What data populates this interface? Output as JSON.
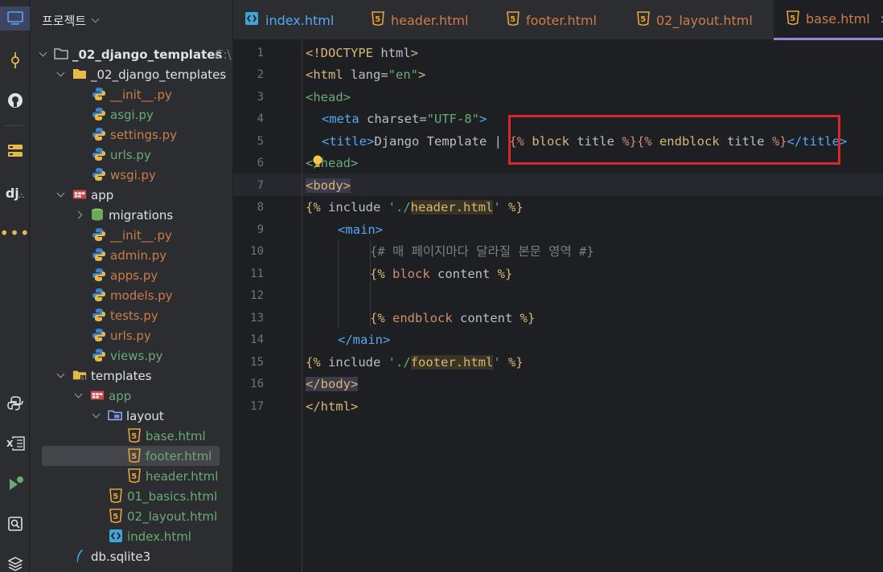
{
  "project_panel": {
    "title": "프로젝트",
    "tree": [
      {
        "label": "_02_django_templates",
        "suffix": "C:\\",
        "type": "root"
      },
      {
        "label": "_02_django_templates",
        "type": "folder"
      },
      {
        "label": "__init__.py",
        "type": "py"
      },
      {
        "label": "asgi.py",
        "type": "py"
      },
      {
        "label": "settings.py",
        "type": "py"
      },
      {
        "label": "urls.py",
        "type": "py"
      },
      {
        "label": "wsgi.py",
        "type": "py"
      },
      {
        "label": "app",
        "type": "app-folder"
      },
      {
        "label": "migrations",
        "type": "db-folder"
      },
      {
        "label": "__init__.py",
        "type": "py"
      },
      {
        "label": "admin.py",
        "type": "py"
      },
      {
        "label": "apps.py",
        "type": "py"
      },
      {
        "label": "models.py",
        "type": "py"
      },
      {
        "label": "tests.py",
        "type": "py"
      },
      {
        "label": "urls.py",
        "type": "py"
      },
      {
        "label": "views.py",
        "type": "py"
      },
      {
        "label": "templates",
        "type": "templates-folder"
      },
      {
        "label": "app",
        "type": "app-folder"
      },
      {
        "label": "layout",
        "type": "layout-folder"
      },
      {
        "label": "base.html",
        "type": "html"
      },
      {
        "label": "footer.html",
        "type": "html"
      },
      {
        "label": "header.html",
        "type": "html"
      },
      {
        "label": "01_basics.html",
        "type": "html"
      },
      {
        "label": "02_layout.html",
        "type": "html"
      },
      {
        "label": "index.html",
        "type": "html-index"
      },
      {
        "label": "db.sqlite3",
        "type": "sqlite"
      }
    ]
  },
  "tabs": [
    {
      "label": "index.html"
    },
    {
      "label": "header.html"
    },
    {
      "label": "footer.html"
    },
    {
      "label": "02_layout.html"
    },
    {
      "label": "base.html",
      "close": "×"
    }
  ],
  "editor": {
    "line_numbers": [
      "1",
      "2",
      "3",
      "4",
      "5",
      "6",
      "7",
      "8",
      "9",
      "10",
      "11",
      "12",
      "13",
      "14",
      "15",
      "16",
      "17"
    ],
    "lines": {
      "l1_a": "<!DOCTYPE",
      "l1_b": " html",
      "l1_c": ">",
      "l2_a": "<html",
      "l2_b": " lang=",
      "l2_c": "\"en\"",
      "l2_d": ">",
      "l3_a": "<head>",
      "l4_a": "<meta",
      "l4_b": " charset=",
      "l4_c": "\"UTF-8\"",
      "l4_d": ">",
      "l5_a": "<title>",
      "l5_b": "Django Template | ",
      "l5_c": "{%",
      "l5_d": " block",
      "l5_e": " title ",
      "l5_f": "%}{%",
      "l5_g": " endblock",
      "l5_h": " title ",
      "l5_i": "%}",
      "l5_j": "</title>",
      "l6_a": "</head>",
      "l7_a": "<body>",
      "l8_a": "{%",
      "l8_b": " include ",
      "l8_c": "'./",
      "l8_d": "header.html",
      "l8_e": "'",
      "l8_f": " %}",
      "l9_a": "<main>",
      "l10_a": "{# 매 페이지마다 달라질 본문 영역 #}",
      "l11_a": "{%",
      "l11_b": " block",
      "l11_c": " content ",
      "l11_d": "%}",
      "l13_a": "{%",
      "l13_b": " endblock",
      "l13_c": " content ",
      "l13_d": "%}",
      "l14_a": "</main>",
      "l15_a": "{%",
      "l15_b": " include ",
      "l15_c": "'./",
      "l15_d": "footer.html",
      "l15_e": "'",
      "l15_f": " %}",
      "l16_a": "</body>",
      "l17_a": "</html>"
    }
  }
}
